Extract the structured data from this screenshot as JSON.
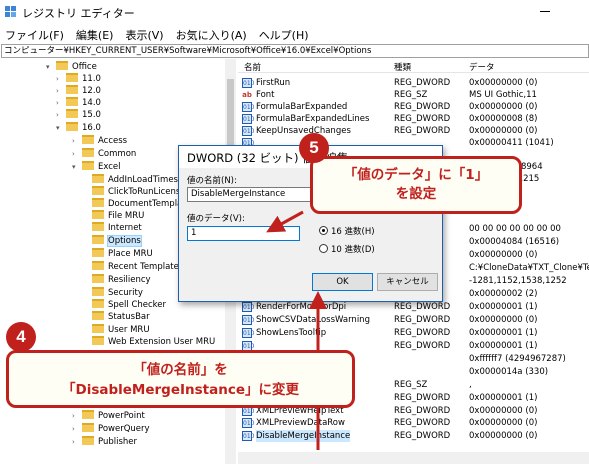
{
  "window": {
    "title": "レジストリ エディター",
    "menu": [
      "ファイル(F)",
      "編集(E)",
      "表示(V)",
      "お気に入り(A)",
      "ヘルプ(H)"
    ],
    "address": "コンピューター¥HKEY_CURRENT_USER¥Software¥Microsoft¥Office¥16.0¥Excel¥Options"
  },
  "tree": {
    "items": [
      {
        "label": "Office",
        "expanded": true
      },
      {
        "label": "11.0",
        "expanded": false
      },
      {
        "label": "12.0",
        "expanded": false
      },
      {
        "label": "14.0",
        "expanded": false
      },
      {
        "label": "15.0",
        "expanded": false
      },
      {
        "label": "16.0",
        "expanded": true
      },
      {
        "label": "Access",
        "expanded": false
      },
      {
        "label": "Common",
        "expanded": false
      },
      {
        "label": "Excel",
        "expanded": true
      },
      {
        "label": "AddInLoadTimes",
        "expanded": false
      },
      {
        "label": "ClickToRunLicensing",
        "expanded": false
      },
      {
        "label": "DocumentTemplateCache",
        "expanded": false
      },
      {
        "label": "File MRU",
        "expanded": false
      },
      {
        "label": "Internet",
        "expanded": false
      },
      {
        "label": "Options",
        "expanded": false,
        "selected": true
      },
      {
        "label": "Place MRU",
        "expanded": false
      },
      {
        "label": "Recent Templates",
        "expanded": false
      },
      {
        "label": "Resiliency",
        "expanded": false
      },
      {
        "label": "Security",
        "expanded": false
      },
      {
        "label": "Spell Checker",
        "expanded": false
      },
      {
        "label": "StatusBar",
        "expanded": false
      },
      {
        "label": "User MRU",
        "expanded": false
      },
      {
        "label": "Web Extension User MRU",
        "expanded": false
      },
      {
        "label": "PowerPoint",
        "expanded": false
      },
      {
        "label": "PowerQuery",
        "expanded": false
      },
      {
        "label": "Publisher",
        "expanded": false
      }
    ]
  },
  "values": {
    "headers": {
      "name": "名前",
      "type": "種類",
      "data": "データ"
    },
    "rows": [
      {
        "name": "FirstRun",
        "type": "REG_DWORD",
        "data": "0x00000000 (0)",
        "icon": "dword-icon"
      },
      {
        "name": "Font",
        "type": "REG_SZ",
        "data": "MS UI Gothic,11",
        "icon": "string-icon"
      },
      {
        "name": "FormulaBarExpanded",
        "type": "REG_DWORD",
        "data": "0x00000000 (0)",
        "icon": "dword-icon"
      },
      {
        "name": "FormulaBarExpandedLines",
        "type": "REG_DWORD",
        "data": "0x00000008 (8)",
        "icon": "dword-icon"
      },
      {
        "name": "KeepUnsavedChanges",
        "type": "REG_DWORD",
        "data": "0x00000000 (0)",
        "icon": "dword-icon"
      },
      {
        "name": "",
        "type": "",
        "data": "0x00000411 (1041)",
        "icon": "dword-icon"
      },
      {
        "name": "",
        "type": "",
        "data": "",
        "icon": "dword-icon"
      },
      {
        "name": "",
        "type": "",
        "data": "...8b676 (698964",
        "icon": "dword-icon"
      },
      {
        "name": "",
        "type": "",
        "data": "...74,48,130,215",
        "icon": "dword-icon"
      },
      {
        "name": "",
        "type": "",
        "data": "",
        "icon": "dword-icon"
      },
      {
        "name": "",
        "type": "",
        "data": "...3)",
        "icon": "dword-icon"
      },
      {
        "name": "",
        "type": "",
        "data": "",
        "icon": "dword-icon"
      },
      {
        "name": "",
        "type": "",
        "data": "00 00 00 00 00 00 00",
        "icon": "dword-icon"
      },
      {
        "name": "",
        "type": "",
        "data": "0x00004084 (16516)",
        "icon": "dword-icon"
      },
      {
        "name": "",
        "type": "",
        "data": "0x00000000 (0)",
        "icon": "dword-icon"
      },
      {
        "name": "",
        "type": "SZ",
        "data": "C:¥CloneData¥TXT_Clone¥Ter",
        "icon": "string-icon"
      },
      {
        "name": "",
        "type": "",
        "data": "-1281,1152,1538,1252",
        "icon": "string-icon"
      },
      {
        "name": "",
        "type": "",
        "data": "0x00000002 (2)",
        "icon": "dword-icon"
      },
      {
        "name": "RenderForMonitorDpi",
        "type": "REG_DWORD",
        "data": "0x00000001 (1)",
        "icon": "dword-icon"
      },
      {
        "name": "ShowCSVDataLossWarning",
        "type": "REG_DWORD",
        "data": "0x00000000 (0)",
        "icon": "dword-icon"
      },
      {
        "name": "ShowLensTooltip",
        "type": "REG_DWORD",
        "data": "0x00000001 (1)",
        "icon": "dword-icon"
      },
      {
        "name": "",
        "type": "REG_DWORD",
        "data": "0x00000001 (1)",
        "icon": "dword-icon"
      },
      {
        "name": "",
        "type": "",
        "data": "0xffffff7 (4294967287)",
        "icon": "dword-icon"
      },
      {
        "name": "",
        "type": "",
        "data": "0x0000014a (330)",
        "icon": "dword-icon"
      },
      {
        "name": "",
        "type": "REG_SZ",
        "data": ",",
        "icon": "string-icon"
      },
      {
        "name": "",
        "type": "REG_DWORD",
        "data": "0x00000001 (1)",
        "icon": "dword-icon"
      },
      {
        "name": "XMLPreviewHelpText",
        "type": "REG_DWORD",
        "data": "0x00000000 (0)",
        "icon": "dword-icon"
      },
      {
        "name": "XMLPreviewDataRow",
        "type": "REG_DWORD",
        "data": "0x00000000 (0)",
        "icon": "dword-icon"
      },
      {
        "name": "DisableMergeInstance",
        "type": "REG_DWORD",
        "data": "0x00000000 (0)",
        "icon": "dword-icon",
        "selected": true
      }
    ]
  },
  "dialog": {
    "title": "DWORD (32 ビット) 値の編集",
    "name_label": "値の名前(N):",
    "name_value": "DisableMergeInstance",
    "data_label": "値のデータ(V):",
    "data_value": "1",
    "radio_hex": "16 進数(H)",
    "radio_dec": "10 進数(D)",
    "radio_selected": "hex",
    "ok": "OK",
    "cancel": "キャンセル"
  },
  "callouts": {
    "step5": {
      "number": "5",
      "line1": "「値のデータ」に「1」",
      "line2": "を設定"
    },
    "step4": {
      "number": "4",
      "line1": "「値の名前」を",
      "line2": "「DisableMergeInstance」に変更"
    }
  },
  "colors": {
    "accent": "#c0211d",
    "selection": "#cce8ff",
    "folder": "#f2c856"
  }
}
